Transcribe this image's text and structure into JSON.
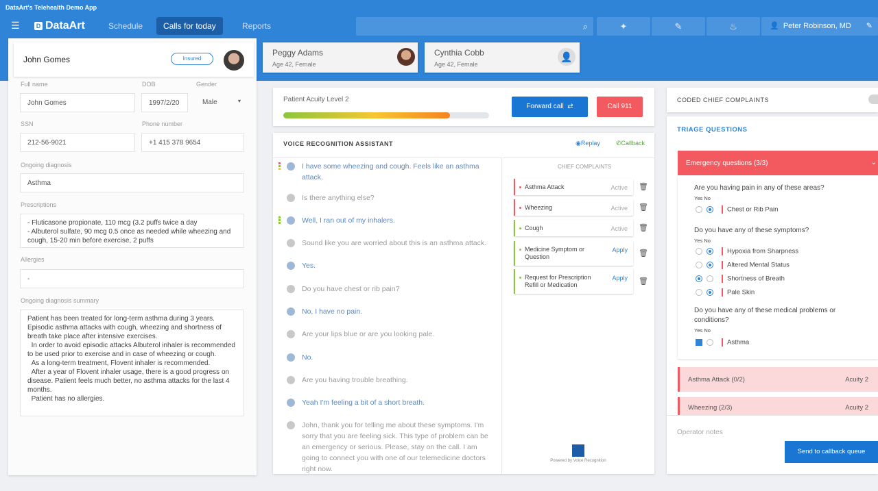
{
  "app": {
    "window_title": "DataArt's Telehealth Demo App",
    "logo": "DataArt",
    "nav": [
      "Schedule",
      "Calls for today",
      "Reports"
    ],
    "active_nav": "Calls for today",
    "user": "Peter Robinson, MD"
  },
  "patient": {
    "name": "John Gomes",
    "pill": "Insured",
    "fields": {
      "full_name_label": "Full name",
      "full_name": "John Gomes",
      "dob_label": "DOB",
      "dob": "1997/2/20",
      "gender_label": "Gender",
      "gender": "Male",
      "ssn_label": "SSN",
      "ssn": "212-56-9021",
      "phone_label": "Phone number",
      "phone": "+1 415 378 9654",
      "ongoing_label": "Ongoing diagnosis",
      "ongoing": "Asthma",
      "prescriptions_label": "Prescriptions",
      "prescriptions": "- Fluticasone propionate, 110 mcg (3.2 puffs twice a day\n- Albuterol sulfate, 90 mcg 0.5 once as needed while wheezing and cough, 15-20 min before exercise, 2 puffs",
      "allergies_label": "Allergies",
      "allergies": "-",
      "summary_label": "Ongoing diagnosis summary",
      "summary": "Patient has been treated for long-term asthma during 3 years. Episodic asthma attacks with cough, wheezing and shortness of breath take place after intensive exercises.\n  In order to avoid episodic attacks Albuterol inhaler is recommended to be used prior to exercise and in case of wheezing or cough.\n  As a long-term treatment, Flovent inhaler is recommended.\n  After a year of Flovent inhaler usage, there is a good progress on disease. Patient feels much better, no asthma attacks for the last 4 months.\n  Patient has no allergies."
    }
  },
  "queue": [
    {
      "name": "Peggy Adams",
      "sub": "Age 42, Female"
    },
    {
      "name": "Cynthia Cobb",
      "sub": "Age 42, Female"
    }
  ],
  "acuity": {
    "label": "Patient Acuity Level 2",
    "fill_fraction": 0.81,
    "forward_label": "Forward call",
    "call911_label": "Call 911"
  },
  "voice": {
    "title": "VOICE RECOGNITION ASSISTANT",
    "replay": "Replay",
    "callback": "Callback",
    "messages": [
      {
        "who": "agent",
        "text": "I have some wheezing and cough. Feels like an asthma attack."
      },
      {
        "who": "patient",
        "text": "Is there anything else?"
      },
      {
        "who": "agent",
        "text": "Well, I ran out of my inhalers."
      },
      {
        "who": "patient",
        "text": "Sound like you are worried about this is an asthma attack."
      },
      {
        "who": "agent",
        "text": "Yes."
      },
      {
        "who": "patient",
        "text": "Do you have chest or rib pain?"
      },
      {
        "who": "agent",
        "text": "No, I have no pain."
      },
      {
        "who": "patient",
        "text": "Are your lips blue or are you looking pale."
      },
      {
        "who": "agent",
        "text": "No."
      },
      {
        "who": "patient",
        "text": "Are you having trouble breathing."
      },
      {
        "who": "agent",
        "text": "Yeah I'm feeling a bit of a short breath."
      },
      {
        "who": "patient",
        "text": "John, thank you for telling me about these symptoms. I'm sorry that you are feeling sick. This type of problem can be an emergency or serious. Please, stay on the call. I am going to connect you with one of our telemedicine doctors right now."
      }
    ],
    "symptoms_header": "CHIEF COMPLAINTS",
    "symptoms": [
      {
        "label": "Asthma Attack",
        "action": "Active",
        "color": "#f25a5f"
      },
      {
        "label": "Wheezing",
        "action": "Active",
        "color": "#f25a5f"
      },
      {
        "label": "Cough",
        "action": "Active",
        "color": "#8cc63f"
      },
      {
        "label": "Medicine Symptom or Question",
        "action": "Apply",
        "color": "#8cc63f"
      },
      {
        "label": "Request for Prescription Refill or Medication",
        "action": "Apply",
        "color": "#8cc63f"
      }
    ],
    "logo_caption": "Powered by Voice Recognition"
  },
  "coded": {
    "title": "CODED CHIEF COMPLAINTS"
  },
  "triage": {
    "title": "TRIAGE QUESTIONS",
    "emergency": "Emergency questions (3/3)",
    "yes_no": "Yes No",
    "q1": "Are you having pain in any of these areas?",
    "q1_opts": [
      "Chest or Rib Pain"
    ],
    "q2": "Do you have any of these symptoms?",
    "q2_opts": [
      "Hypoxia from Sharpness",
      "Altered Mental Status",
      "Shortness of Breath",
      "Pale Skin"
    ],
    "q3": "Do you have any of these medical problems or conditions?",
    "q3_opts": [
      "Asthma"
    ],
    "sections": [
      {
        "label": "Asthma Attack (0/2)",
        "acuity": "Acuity 2"
      },
      {
        "label": "Wheezing (2/3)",
        "acuity": "Acuity 2"
      }
    ],
    "notes": "Operator notes",
    "send": "Send to callback queue"
  }
}
